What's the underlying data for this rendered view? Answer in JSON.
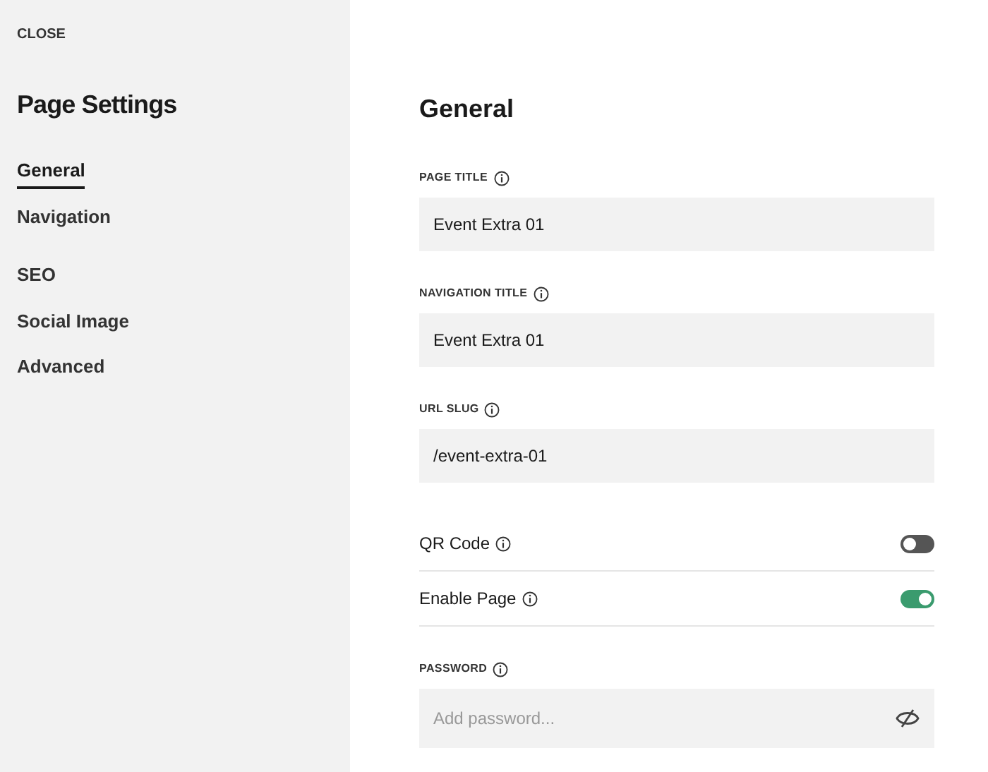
{
  "sidebar": {
    "close": "CLOSE",
    "title": "Page Settings",
    "groups": [
      {
        "items": [
          {
            "label": "General",
            "selected": true
          },
          {
            "label": "Navigation",
            "selected": false
          }
        ]
      },
      {
        "items": [
          {
            "label": "SEO",
            "selected": false
          },
          {
            "label": "Social Image",
            "selected": false
          },
          {
            "label": "Advanced",
            "selected": false
          }
        ]
      }
    ]
  },
  "main": {
    "heading": "General",
    "fields": [
      {
        "kind": "text",
        "label": "PAGE TITLE",
        "value": "Event Extra 01"
      },
      {
        "kind": "text",
        "label": "NAVIGATION TITLE",
        "value": "Event Extra 01"
      },
      {
        "kind": "text",
        "label": "URL SLUG",
        "value": "/event-extra-01"
      },
      {
        "kind": "toggle",
        "label": "QR Code",
        "on": false
      },
      {
        "kind": "toggle",
        "label": "Enable Page",
        "on": true
      },
      {
        "kind": "password",
        "label": "PASSWORD",
        "placeholder": "Add password..."
      }
    ]
  }
}
